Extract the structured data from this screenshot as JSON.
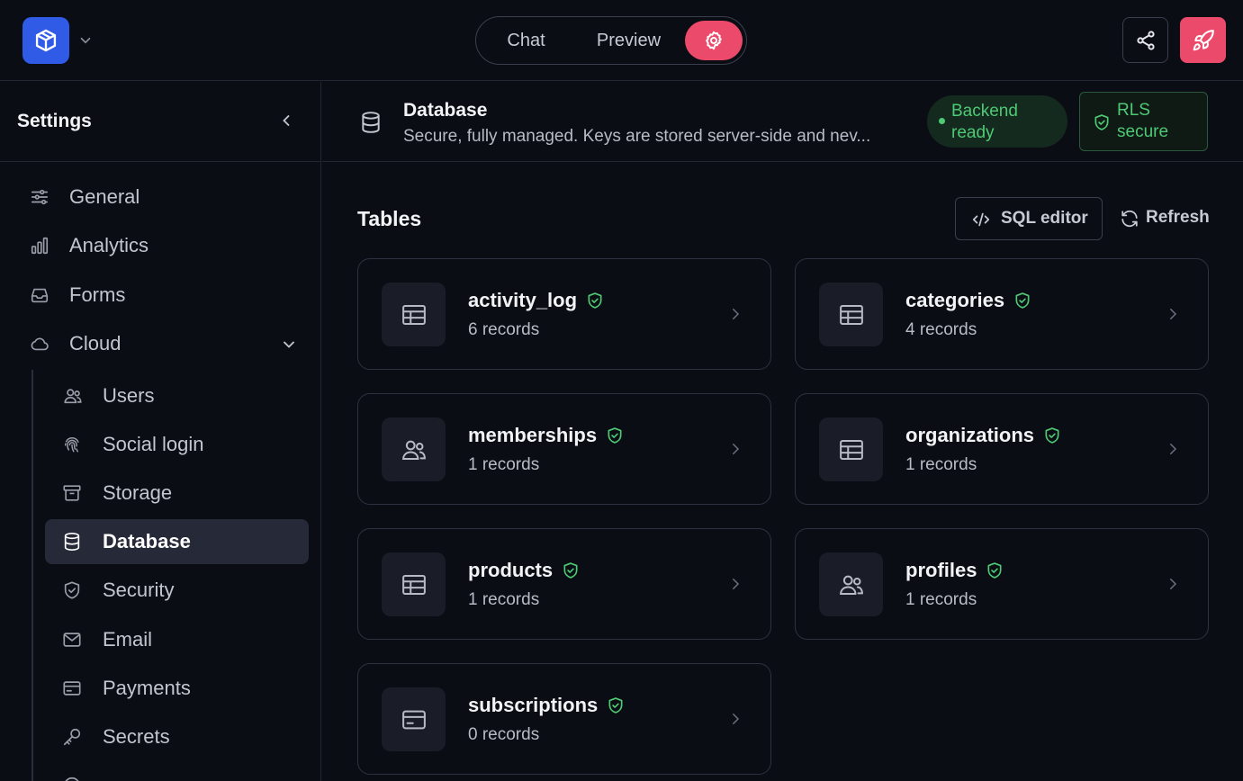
{
  "topbar": {
    "mode_tabs": {
      "chat": "Chat",
      "preview": "Preview"
    }
  },
  "sidebar": {
    "title": "Settings",
    "items": [
      {
        "label": "General",
        "icon": "sliders-icon"
      },
      {
        "label": "Analytics",
        "icon": "bar-chart-icon"
      },
      {
        "label": "Forms",
        "icon": "inbox-icon"
      },
      {
        "label": "Cloud",
        "icon": "cloud-icon"
      }
    ],
    "cloud_items": [
      {
        "label": "Users",
        "icon": "users-icon"
      },
      {
        "label": "Social login",
        "icon": "fingerprint-icon"
      },
      {
        "label": "Storage",
        "icon": "archive-icon"
      },
      {
        "label": "Database",
        "icon": "database-icon"
      },
      {
        "label": "Security",
        "icon": "shield-icon"
      },
      {
        "label": "Email",
        "icon": "mail-icon"
      },
      {
        "label": "Payments",
        "icon": "credit-card-icon"
      },
      {
        "label": "Secrets",
        "icon": "key-icon"
      }
    ],
    "active_item": "Database"
  },
  "header": {
    "title": "Database",
    "description": "Secure, fully managed. Keys are stored server-side and nev...",
    "backend_badge": "Backend ready",
    "rls_badge": "RLS secure"
  },
  "tables_section": {
    "title": "Tables",
    "sql_editor_label": "SQL editor",
    "refresh_label": "Refresh"
  },
  "tables": [
    {
      "name": "activity_log",
      "records": "6 records",
      "icon": "table-icon"
    },
    {
      "name": "categories",
      "records": "4 records",
      "icon": "table-icon"
    },
    {
      "name": "memberships",
      "records": "1 records",
      "icon": "users-icon"
    },
    {
      "name": "organizations",
      "records": "1 records",
      "icon": "table-icon"
    },
    {
      "name": "products",
      "records": "1 records",
      "icon": "table-icon"
    },
    {
      "name": "profiles",
      "records": "1 records",
      "icon": "users-icon"
    },
    {
      "name": "subscriptions",
      "records": "0 records",
      "icon": "credit-card-icon"
    }
  ],
  "colors": {
    "accent_pink": "#ec4a6b",
    "brand_blue": "#2f5be6",
    "success_green": "#4ec974"
  }
}
